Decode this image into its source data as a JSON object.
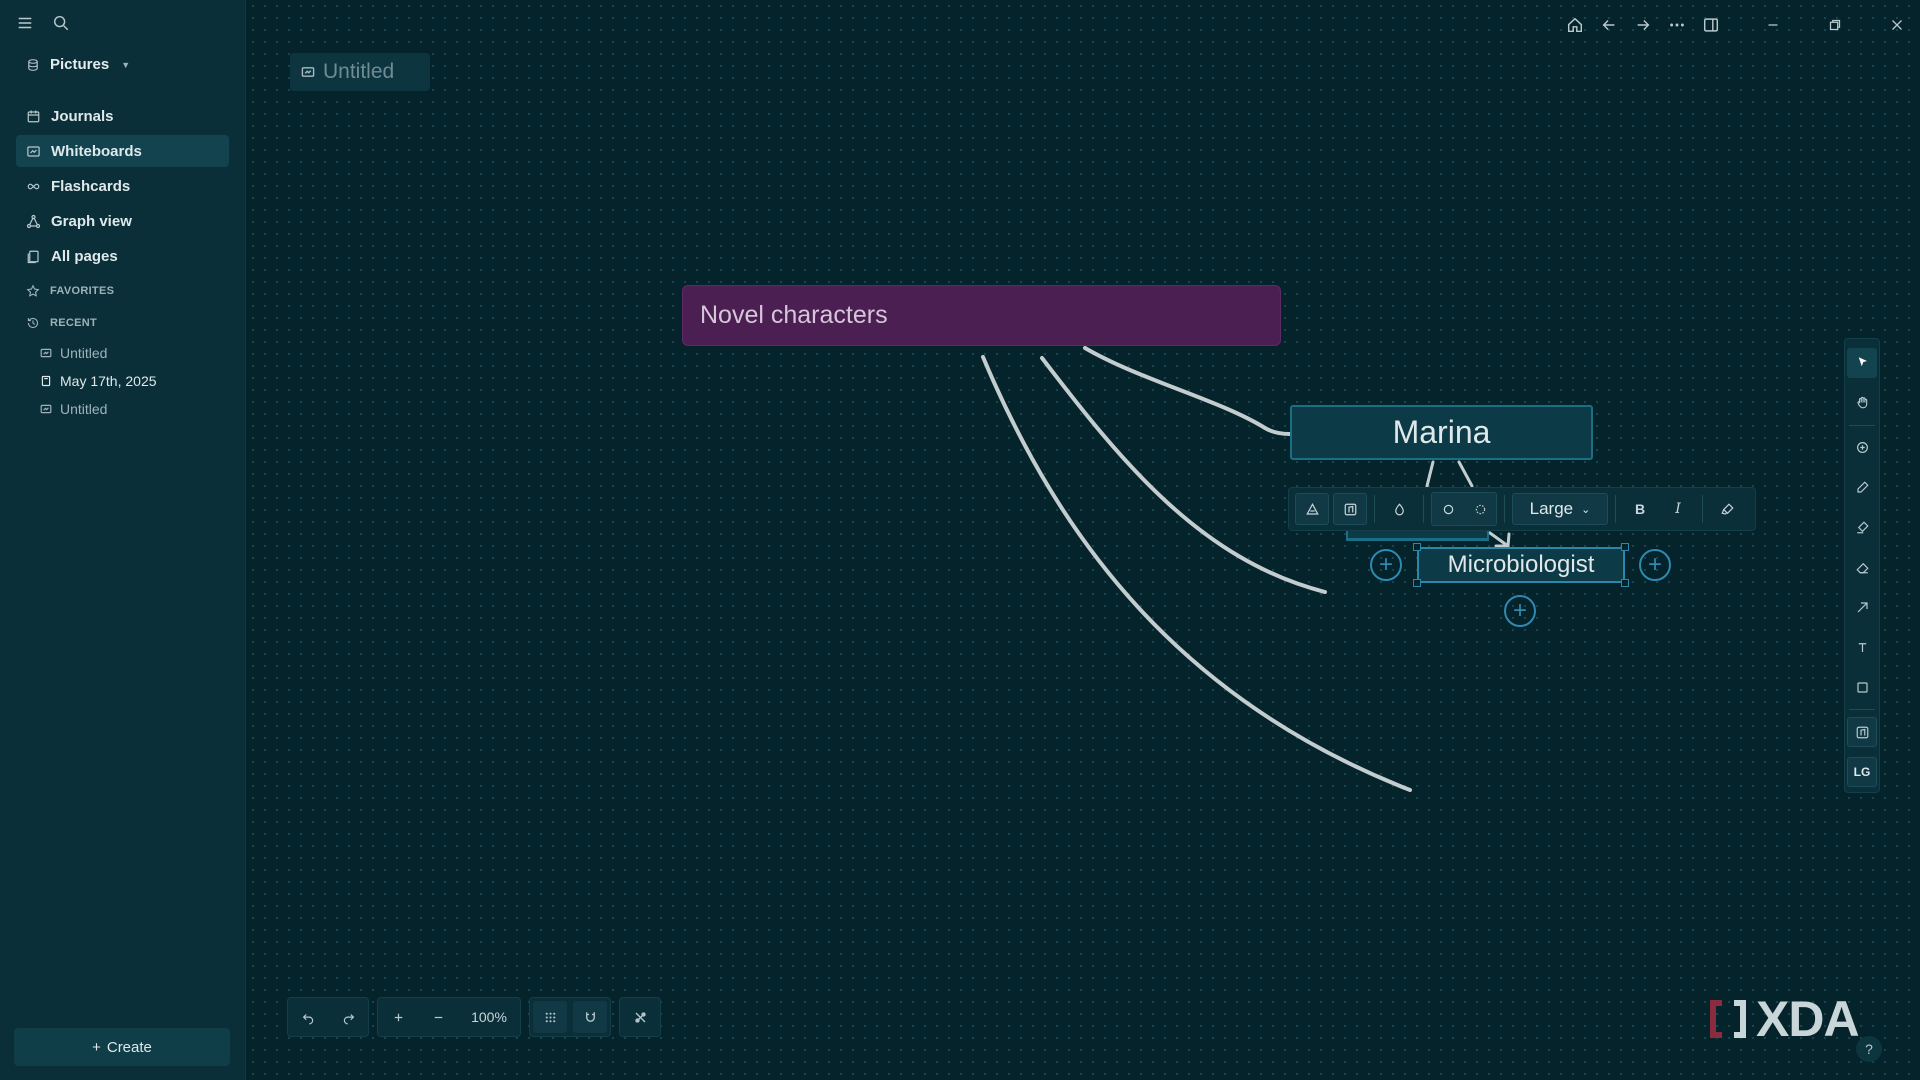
{
  "sidebar": {
    "graph_name": "Pictures",
    "nav": [
      {
        "label": "Journals",
        "icon": "calendar-icon"
      },
      {
        "label": "Whiteboards",
        "icon": "whiteboard-icon",
        "active": true
      },
      {
        "label": "Flashcards",
        "icon": "infinity-icon"
      },
      {
        "label": "Graph view",
        "icon": "graph-icon"
      },
      {
        "label": "All pages",
        "icon": "pages-icon"
      }
    ],
    "favorites_label": "FAVORITES",
    "recent_label": "RECENT",
    "recent": [
      {
        "label": "Untitled",
        "icon": "whiteboard-icon"
      },
      {
        "label": "May 17th, 2025",
        "icon": "journal-icon"
      },
      {
        "label": "Untitled",
        "icon": "whiteboard-icon"
      }
    ],
    "create_label": "Create"
  },
  "page": {
    "title_placeholder": "Untitled"
  },
  "board": {
    "title_node": "Novel characters",
    "node_marina": "Marina",
    "node_microbiologist": "Microbiologist"
  },
  "format_toolbar": {
    "size_value": "Large",
    "bold_label": "B",
    "italic_label": "I"
  },
  "right_tools": {
    "lg_label": "LG"
  },
  "bottom": {
    "zoom": "100%"
  },
  "watermark": "XDA",
  "help_label": "?",
  "colors": {
    "background": "#05232b",
    "sidebar": "#0a2f39",
    "title_node": "#4c1f52",
    "node_border": "#1a6f85",
    "selection": "#2b86a8"
  }
}
